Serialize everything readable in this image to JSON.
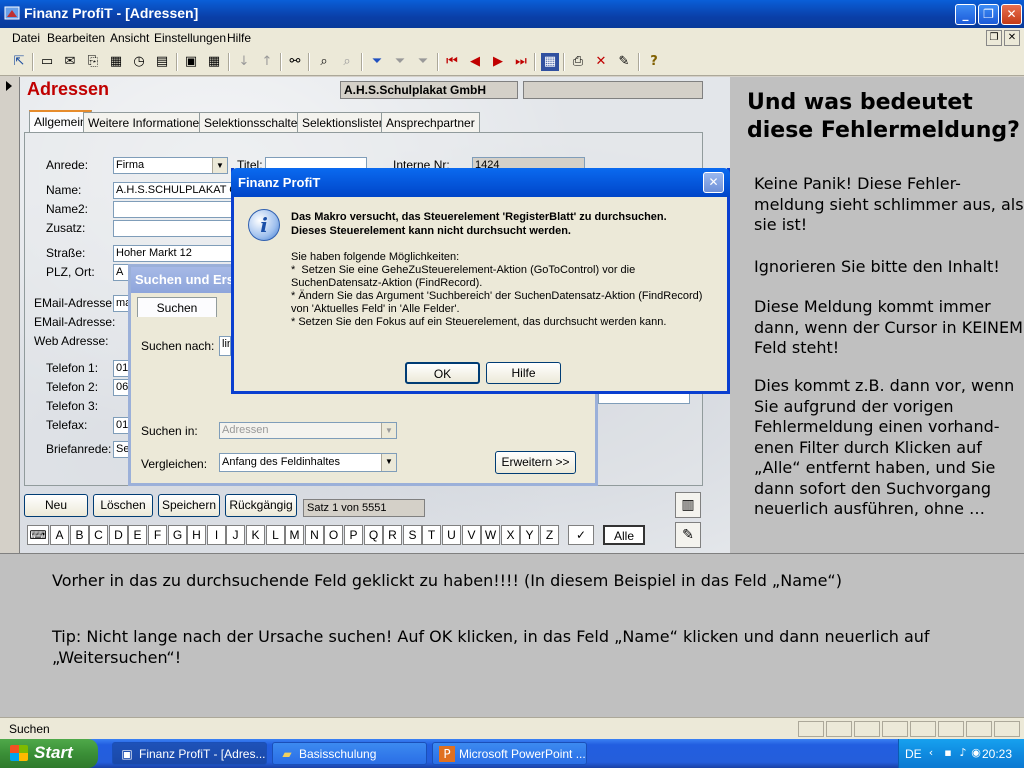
{
  "window": {
    "title": "Finanz ProfiT - [Adressen]",
    "icons": {
      "app": "finanz-app-icon",
      "minimize": "minimize-icon",
      "restore": "restore-icon",
      "close": "close-icon"
    }
  },
  "menu": {
    "items": [
      "Datei",
      "Bearbeiten",
      "Ansicht",
      "Einstellungen",
      "Hilfe"
    ]
  },
  "toolbar": {
    "icons": [
      "exit-icon",
      "print-preview-icon",
      "note-icon",
      "copy-icon",
      "calculator-icon",
      "clock-icon",
      "stack-icon",
      "form-view-icon",
      "table-view-icon",
      "sort-ascending-icon",
      "sort-descending-icon",
      "binoculars-icon",
      "zoom-page-icon",
      "zoom-icon",
      "filter-icon",
      "filter-apply-icon",
      "filter-remove-icon",
      "first-record-icon",
      "previous-record-icon",
      "next-record-icon",
      "last-record-icon",
      "grid-icon",
      "printer-icon",
      "delete-icon",
      "edit-icon",
      "help-icon"
    ]
  },
  "form": {
    "title": "Adressen",
    "company": "A.H.S.Schulplakat GmbH",
    "tabs": [
      "Allgemein",
      "Weitere Informationen",
      "Selektionsschalter",
      "Selektionslisten",
      "Ansprechpartner"
    ],
    "fields": {
      "anrede_label": "Anrede:",
      "anrede_value": "Firma",
      "titel_label": "Titel:",
      "internr_label": "Interne Nr:",
      "internr_value": "1424",
      "name_label": "Name:",
      "name_value": "A.H.S.SCHULPLAKAT G",
      "name2_label": "Name2:",
      "zusatz_label": "Zusatz:",
      "strasse_label": "Straße:",
      "strasse_value": "Hoher Markt 12",
      "plz_label": "PLZ, Ort:",
      "plz_value": "A",
      "email1_label": "EMail-Adresse:",
      "email1_value": "ma",
      "email2_label": "EMail-Adresse:",
      "web_label": "Web Adresse:",
      "tel1_label": "Telefon 1:",
      "tel1_value": "01",
      "tel2_label": "Telefon 2:",
      "tel2_value": "06",
      "tel3_label": "Telefon 3:",
      "fax_label": "Telefax:",
      "fax_value": "01",
      "brief_label": "Briefanrede:",
      "brief_value": "Se"
    },
    "buttons": {
      "neu": "Neu",
      "loeschen": "Löschen",
      "speichern": "Speichern",
      "rueckgaengig": "Rückgängig"
    },
    "record_status": "Satz 1 von 5551",
    "letters": [
      "A",
      "B",
      "C",
      "D",
      "E",
      "F",
      "G",
      "H",
      "I",
      "J",
      "K",
      "L",
      "M",
      "N",
      "O",
      "P",
      "Q",
      "R",
      "S",
      "T",
      "U",
      "V",
      "W",
      "X",
      "Y",
      "Z"
    ],
    "alle": "Alle"
  },
  "search_dialog": {
    "title": "Suchen und Ers",
    "tab": "Suchen",
    "suchen_nach_label": "Suchen nach:",
    "suchen_nach_value": "lin",
    "suchen_in_label": "Suchen in:",
    "suchen_in_value": "Adressen",
    "vergleichen_label": "Vergleichen:",
    "vergleichen_value": "Anfang des Feldinhaltes",
    "erweitern": "Erweitern >>"
  },
  "message_dialog": {
    "title": "Finanz ProfiT",
    "bold_line1": "Das Makro versucht, das Steuerelement 'RegisterBlatt' zu durchsuchen.",
    "bold_line2": "Dieses Steuerelement kann nicht durchsucht werden.",
    "body": [
      "Sie haben folgende Möglichkeiten:",
      "*  Setzen Sie eine GeheZuSteuerelement-Aktion (GoToControl) vor die SuchenDatensatz-Aktion (FindRecord).",
      "* Ändern Sie das Argument 'Suchbereich' der SuchenDatensatz-Aktion (FindRecord) von 'Aktuelles Feld' in 'Alle Felder'.",
      "* Setzen Sie den Fokus auf ein Steuerelement, das durchsucht werden kann."
    ],
    "ok": "OK",
    "hilfe": "Hilfe"
  },
  "explanation": {
    "heading": "Und was bedeutet diese Fehlermeldung?",
    "p1": "Keine Panik! Diese Fehler-meldung sieht schlimmer aus, als sie ist!",
    "p2": "Ignorieren Sie bitte den Inhalt!",
    "p3": "Diese Meldung kommt immer dann, wenn der Cursor in KEINEM Feld steht!",
    "p4": "Dies kommt z.B. dann vor, wenn Sie aufgrund der vorigen Fehlermeldung einen vorhand-enen Filter durch Klicken auf „Alle“ entfernt haben, und Sie dann sofort den Suchvorgang neuerlich ausführen, ohne …",
    "bottom1": "Vorher in das zu durchsuchende Feld geklickt zu haben!!!! (In diesem Beispiel in das Feld „Name“)",
    "bottom2": "Tip: Nicht lange nach der Ursache suchen! Auf OK klicken, in das Feld „Name“ klicken und dann neuerlich auf „Weitersuchen“!"
  },
  "status": {
    "text": "Suchen"
  },
  "taskbar": {
    "start": "Start",
    "items": [
      "Finanz ProfiT - [Adres...",
      "Basisschulung",
      "Microsoft PowerPoint ..."
    ],
    "language": "DE",
    "time": "20:23"
  }
}
